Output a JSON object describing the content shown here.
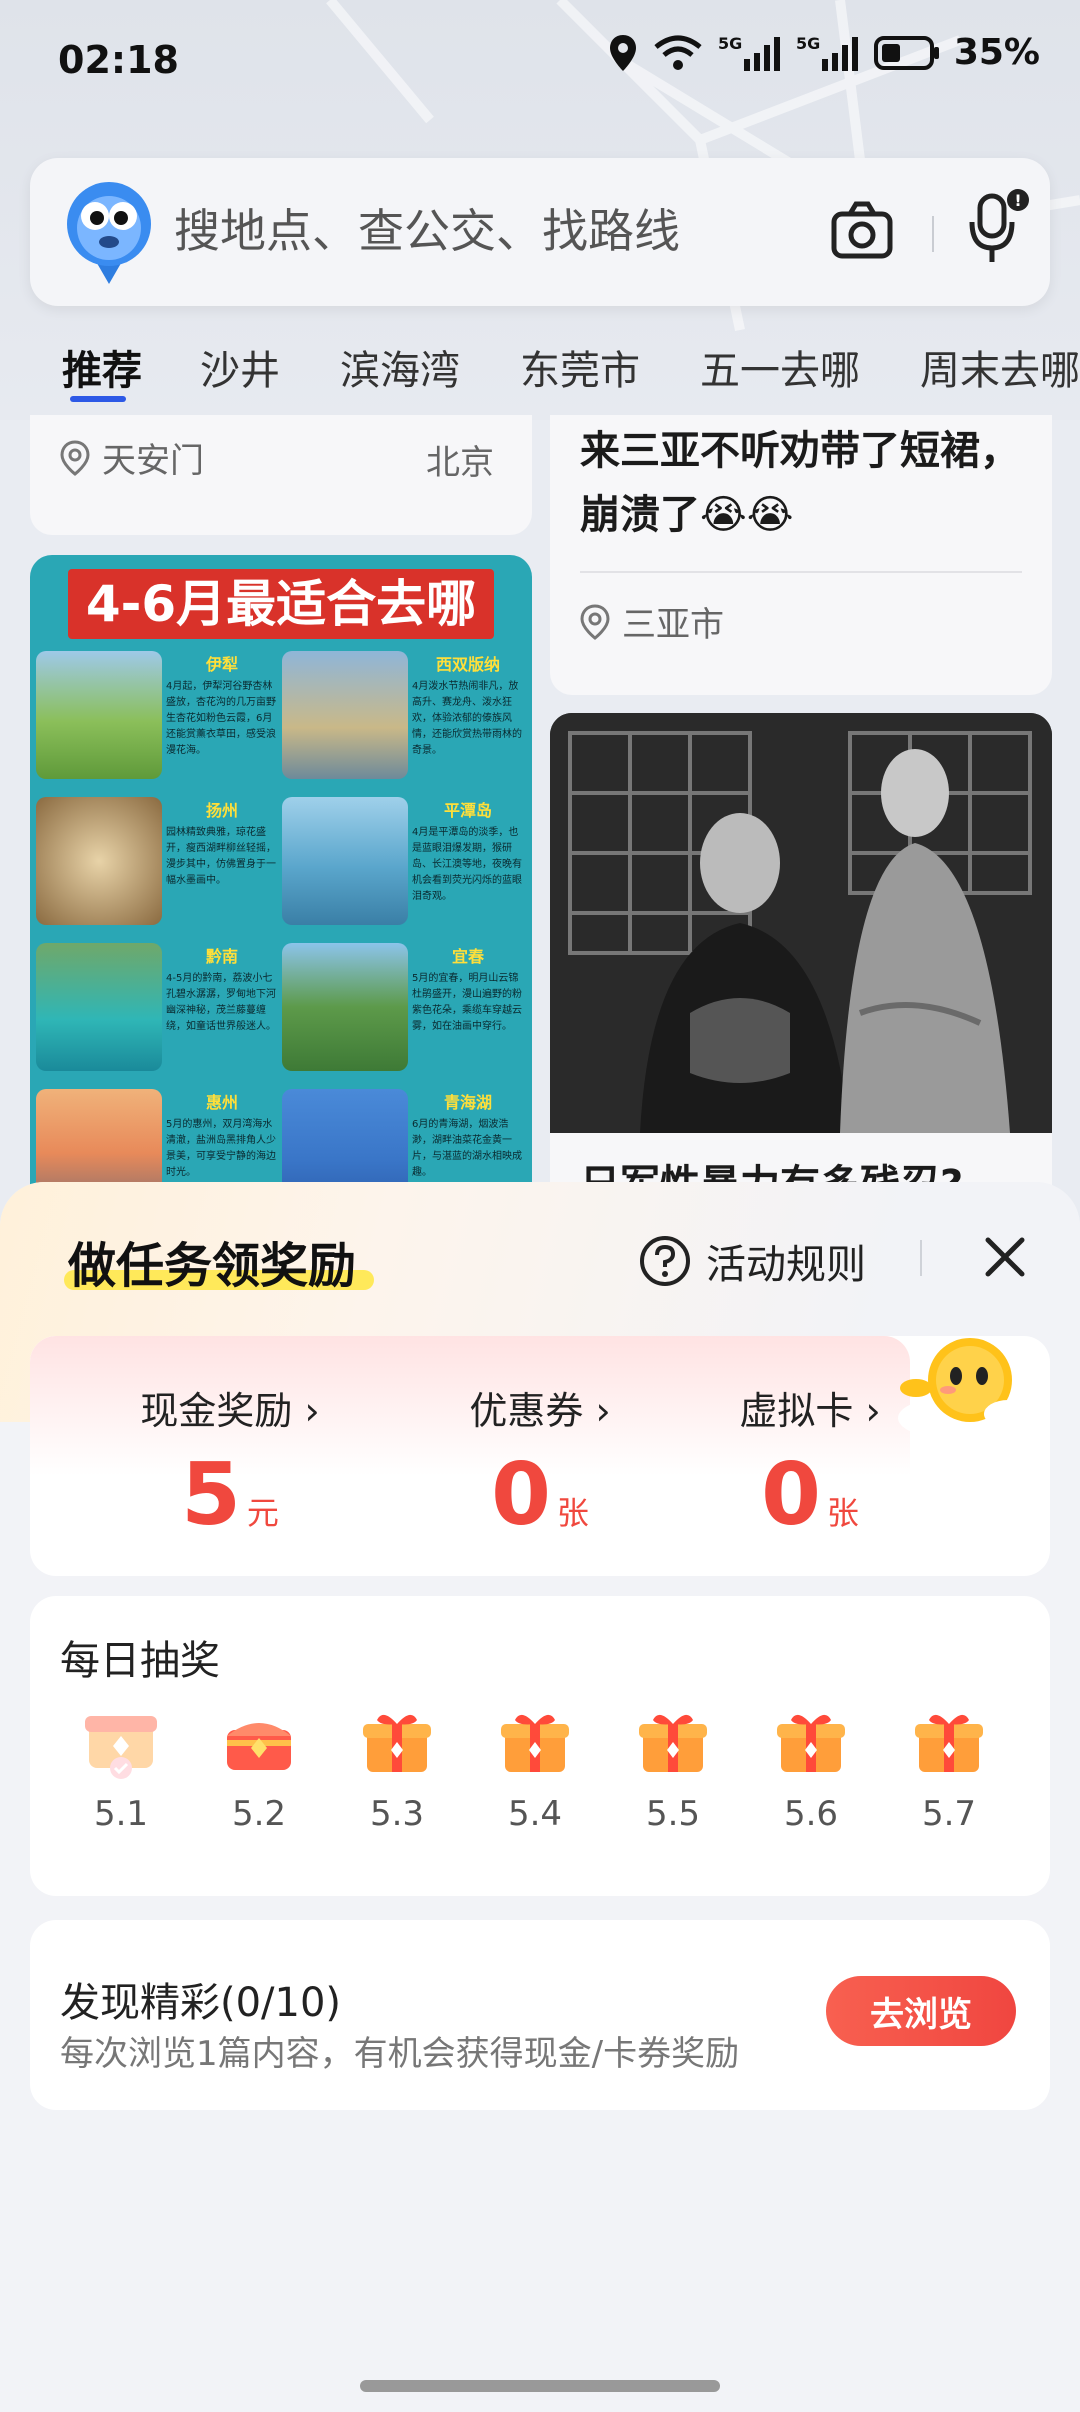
{
  "status_bar": {
    "time": "02:18",
    "battery": "35%"
  },
  "search": {
    "placeholder": "搜地点、查公交、找路线"
  },
  "tabs": [
    {
      "label": "推荐",
      "active": true
    },
    {
      "label": "沙井"
    },
    {
      "label": "滨海湾"
    },
    {
      "label": "东莞市"
    },
    {
      "label": "五一去哪"
    },
    {
      "label": "周末去哪"
    }
  ],
  "feed": {
    "card_left_top": {
      "location": "天安门",
      "city": "北京"
    },
    "card_right_top": {
      "title": "来三亚不听劝带了短裙，崩溃了😭😭",
      "location": "三亚市"
    },
    "poster": {
      "heading": "4-6月最适合去哪",
      "cells": [
        {
          "name": "伊犁",
          "text": "4月起，伊犁河谷野杏林盛放，杏花沟的几万亩野生杏花如粉色云霞，6月还能赏薰衣草田，感受浪漫花海。"
        },
        {
          "name": "西双版纳",
          "text": "4月泼水节热闹非凡，放高升、赛龙舟、泼水狂欢，体验浓郁的傣族风情，还能欣赏热带雨林的奇景。"
        },
        {
          "name": "扬州",
          "text": "园林精致典雅，琼花盛开，瘦西湖畔柳丝轻摇，漫步其中，仿佛置身于一幅水墨画中。"
        },
        {
          "name": "平潭岛",
          "text": "4月是平潭岛的淡季，也是蓝眼泪爆发期，猴研岛、长江澳等地，夜晚有机会看到荧光闪烁的蓝眼泪奇观。"
        },
        {
          "name": "黔南",
          "text": "4-5月的黔南，荔波小七孔碧水潺潺，罗甸地下河幽深神秘，茂兰藤蔓缠绕，如童话世界般迷人。"
        },
        {
          "name": "宜春",
          "text": "5月的宜春，明月山云锦杜鹃盛开，漫山遍野的粉紫色花朵，乘缆车穿越云雾，如在油画中穿行。"
        },
        {
          "name": "惠州",
          "text": "5月的惠州，双月湾海水清澈，盐洲岛黑排角人少景美，可享受宁静的海边时光。"
        },
        {
          "name": "青海湖",
          "text": "6月的青海湖，烟波浩渺，湖畔油菜花金黄一片，与湛蓝的湖水相映成趣。"
        }
      ]
    },
    "card_right_bottom": {
      "title": "日军性暴力有多残忍?"
    }
  },
  "sheet": {
    "title": "做任务领奖励",
    "rules": "活动规则",
    "rewards": [
      {
        "label": "现金奖励 ›",
        "value": "5",
        "unit": "元"
      },
      {
        "label": "优惠券 ›",
        "value": "0",
        "unit": "张"
      },
      {
        "label": "虚拟卡 ›",
        "value": "0",
        "unit": "张"
      }
    ],
    "lottery": {
      "title": "每日抽奖",
      "days": [
        {
          "date": "5.1",
          "state": "claimed"
        },
        {
          "date": "5.2",
          "state": "open"
        },
        {
          "date": "5.3",
          "state": "locked"
        },
        {
          "date": "5.4",
          "state": "locked"
        },
        {
          "date": "5.5",
          "state": "locked"
        },
        {
          "date": "5.6",
          "state": "locked"
        },
        {
          "date": "5.7",
          "state": "locked"
        }
      ]
    },
    "discover": {
      "title": "发现精彩(0/10)",
      "subtitle": "每次浏览1篇内容，有机会获得现金/卡券奖励",
      "button": "去浏览"
    }
  },
  "colors": {
    "accent": "#f0483e",
    "tab_underline": "#2d59e6",
    "highlight": "#ffe95a",
    "poster_bg": "#2aa7b5"
  }
}
